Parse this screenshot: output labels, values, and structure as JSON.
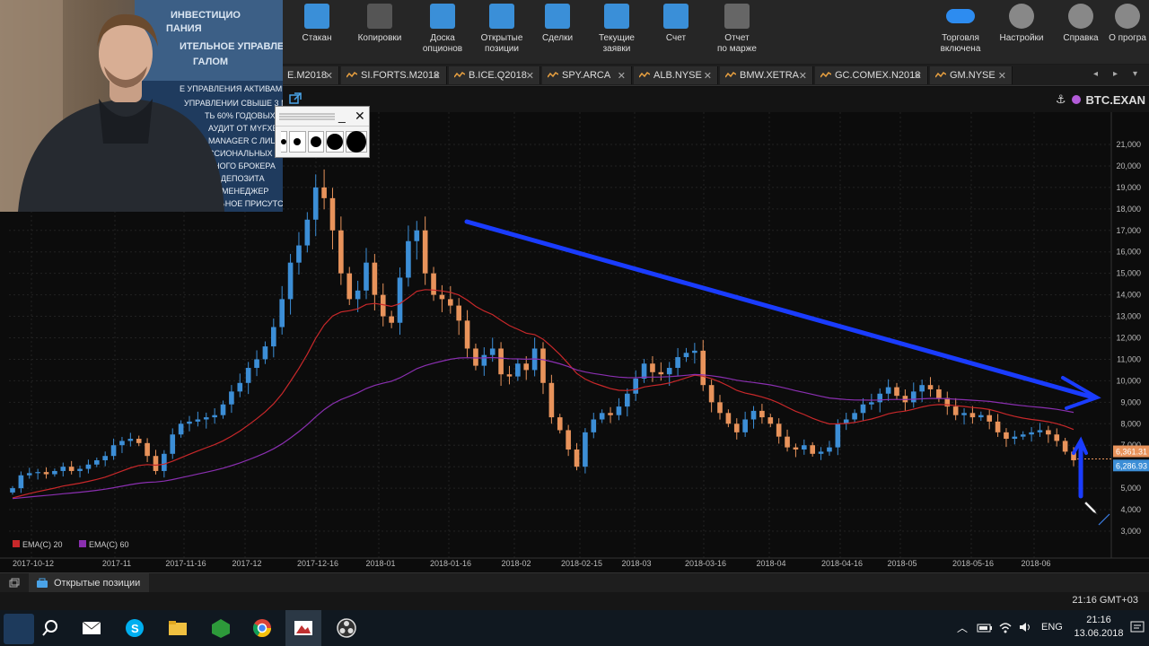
{
  "toolbar": {
    "buttons": [
      {
        "label": "Стакан",
        "icon": "order-book-icon"
      },
      {
        "label": "Копировки",
        "icon": "copy-trading-icon"
      },
      {
        "label": "Доска\nопционов",
        "icon": "options-board-icon"
      },
      {
        "label": "Открытые\nпозиции",
        "icon": "briefcase-icon"
      },
      {
        "label": "Сделки",
        "icon": "trades-book-icon"
      },
      {
        "label": "Текущие\nзаявки",
        "icon": "gavel-icon"
      },
      {
        "label": "Счет",
        "icon": "account-calculator-icon"
      },
      {
        "label": "Отчет\nпо марже",
        "icon": "percent-report-icon"
      }
    ],
    "right_buttons": [
      {
        "label": "Торговля\nвключена",
        "icon": "toggle-icon"
      },
      {
        "label": "Настройки",
        "icon": "gear-icon"
      },
      {
        "label": "Справка",
        "icon": "help-icon"
      },
      {
        "label": "О програ",
        "icon": "info-icon"
      }
    ]
  },
  "tabs": [
    "E.M2018",
    "SI.FORTS.M2018",
    "B.ICE.Q2018",
    "SPY.ARCA",
    "ALB.NYSE",
    "BMW.XETRA",
    "GC.COMEX.N2018",
    "GM.NYSE"
  ],
  "symbol": "BTC.EXAN",
  "palette_sizes": [
    3,
    4,
    6,
    9,
    12
  ],
  "colors": {
    "accent_blue": "#1a3cff",
    "ema20": "#c8282a",
    "ema60": "#8a2fb0",
    "up": "#3c8ed6",
    "down": "#e8935b"
  },
  "chart_data": {
    "type": "candlestick",
    "y_ticks": [
      "21,000",
      "20,000",
      "19,000",
      "18,000",
      "17,000",
      "16,000",
      "15,000",
      "14,000",
      "13,000",
      "12,000",
      "11,000",
      "10,000",
      "9,000",
      "8,000",
      "7,000",
      "6,000",
      "5,000",
      "4,000",
      "3,000"
    ],
    "x_ticks": [
      "2017-10-12",
      "2017-11",
      "2017-11-16",
      "2017-12",
      "2017-12-16",
      "2018-01",
      "2018-01-16",
      "2018-02",
      "2018-02-15",
      "2018-03",
      "2018-03-16",
      "2018-04",
      "2018-04-16",
      "2018-05",
      "2018-05-16",
      "2018-06"
    ],
    "ylim": [
      3000,
      21000
    ],
    "price_labels": [
      "6,361.31",
      "6,286.93"
    ],
    "price_values": [
      6361.31,
      6286.93
    ],
    "legend": [
      {
        "name": "EMA(C) 20",
        "color": "#c8282a"
      },
      {
        "name": "EMA(C) 60",
        "color": "#8a2fb0"
      }
    ],
    "closes": [
      5000,
      5600,
      5700,
      5750,
      5650,
      5800,
      6000,
      5800,
      5900,
      6100,
      6300,
      6500,
      7000,
      7200,
      7300,
      7100,
      6500,
      5800,
      6600,
      7500,
      8000,
      8100,
      8200,
      8300,
      8400,
      8900,
      9500,
      9900,
      10600,
      11000,
      11600,
      12500,
      13800,
      15500,
      16300,
      17500,
      19000,
      18500,
      17000,
      15000,
      13800,
      14200,
      15500,
      14000,
      13000,
      12700,
      14800,
      16500,
      17000,
      15000,
      14000,
      13800,
      13500,
      12800,
      11500,
      10700,
      11200,
      11500,
      10300,
      10200,
      10800,
      10500,
      11500,
      9900,
      8300,
      7700,
      6800,
      6000,
      7600,
      8200,
      8500,
      8400,
      8800,
      9400,
      10100,
      10800,
      10400,
      10300,
      10600,
      11100,
      11300,
      11400,
      9800,
      9000,
      8500,
      8000,
      7600,
      8200,
      8600,
      8300,
      8000,
      7400,
      6900,
      6800,
      7000,
      6600,
      6700,
      6900,
      8000,
      8200,
      8500,
      8900,
      9000,
      9400,
      9700,
      9300,
      9000,
      9500,
      9800,
      9600,
      9200,
      8800,
      8400,
      8500,
      8300,
      8400,
      8100,
      7600,
      7300,
      7400,
      7500,
      7600,
      7700,
      7500,
      7200,
      6700,
      6300
    ]
  },
  "bottom": {
    "positions_tab": "Открытые позиции",
    "status_time": "21:16 GMT+03"
  },
  "taskbar": {
    "lang": "ENG",
    "time": "21:16",
    "date": "13.06.2018"
  }
}
